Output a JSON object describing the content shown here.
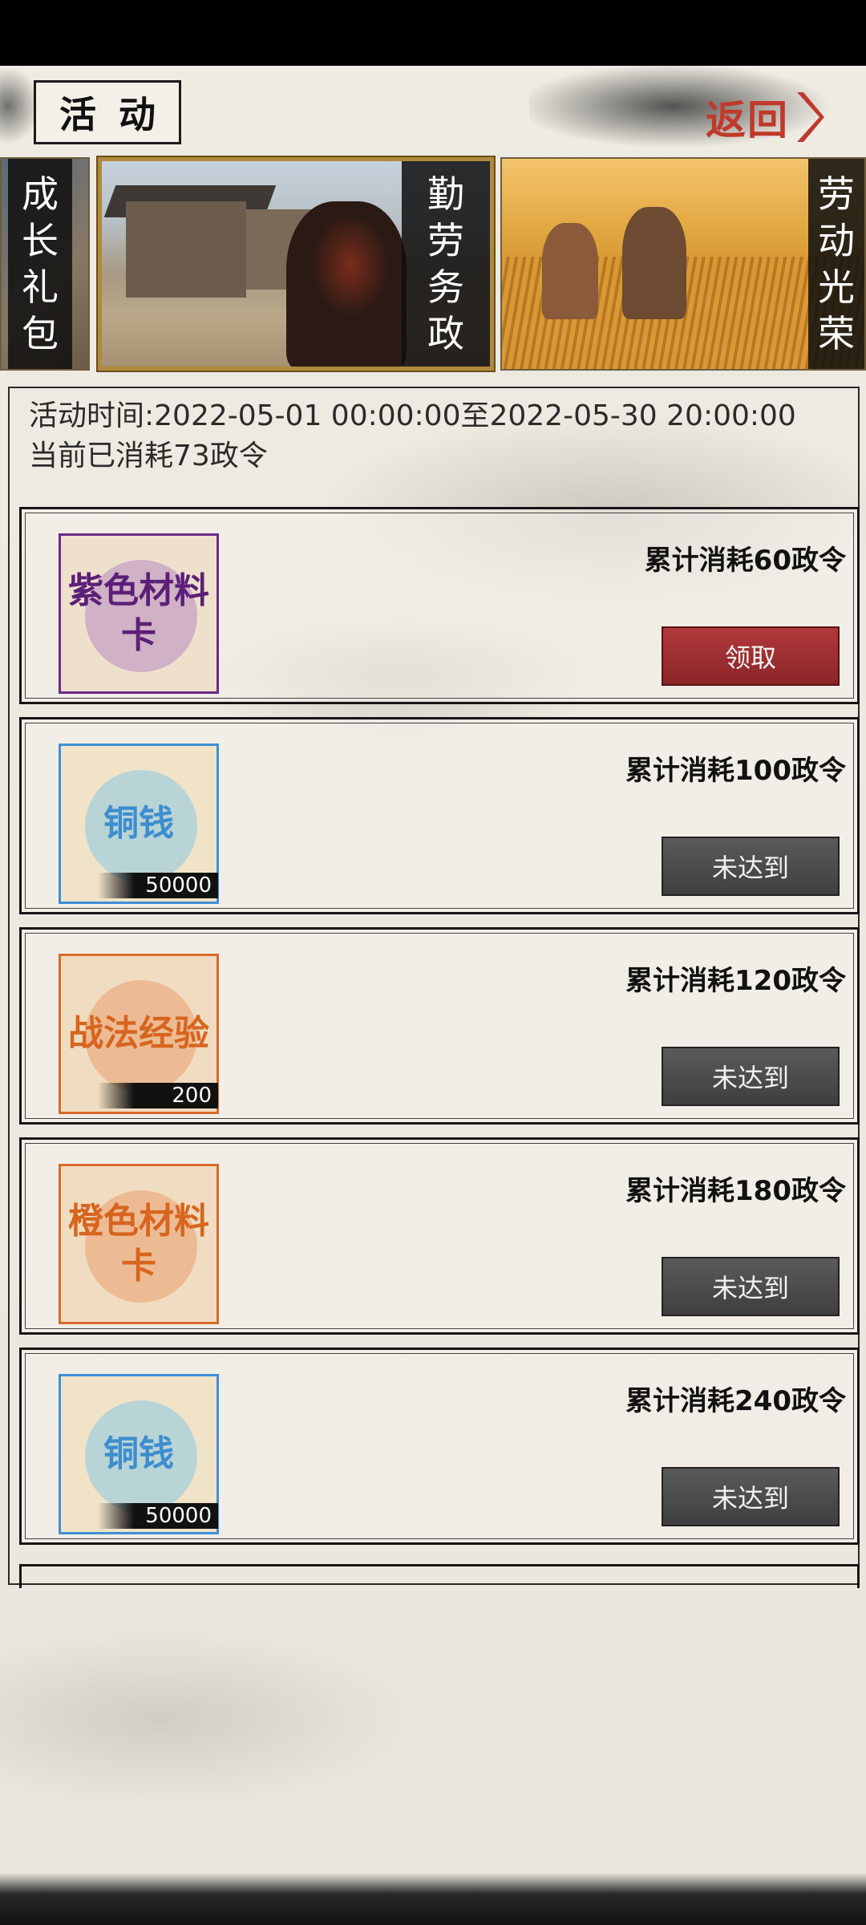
{
  "header": {
    "title": "活动",
    "back_label": "返回"
  },
  "tabs": [
    {
      "label": "成长礼包"
    },
    {
      "label": "勤劳务政"
    },
    {
      "label": "劳动光荣"
    }
  ],
  "activity": {
    "time_text": "活动时间:2022-05-01 00:00:00至2022-05-30 20:00:00",
    "consumed_text": "当前已消耗73政令"
  },
  "rewards": [
    {
      "item_name": "紫色材料卡",
      "quantity": "",
      "requirement": "累计消耗60政令",
      "button": "领取",
      "status": "claimable"
    },
    {
      "item_name": "铜钱",
      "quantity": "50000",
      "requirement": "累计消耗100政令",
      "button": "未达到",
      "status": "locked"
    },
    {
      "item_name": "战法经验",
      "quantity": "200",
      "requirement": "累计消耗120政令",
      "button": "未达到",
      "status": "locked"
    },
    {
      "item_name": "橙色材料卡",
      "quantity": "",
      "requirement": "累计消耗180政令",
      "button": "未达到",
      "status": "locked"
    },
    {
      "item_name": "铜钱",
      "quantity": "50000",
      "requirement": "累计消耗240政令",
      "button": "未达到",
      "status": "locked"
    }
  ],
  "colors": {
    "claim_button": "#9e2f31",
    "locked_button": "#4a4a4a",
    "back_text": "#c0392b",
    "purple_item": "#5b1f78",
    "blue_item": "#3d8ecf",
    "orange_item": "#d7651f"
  }
}
